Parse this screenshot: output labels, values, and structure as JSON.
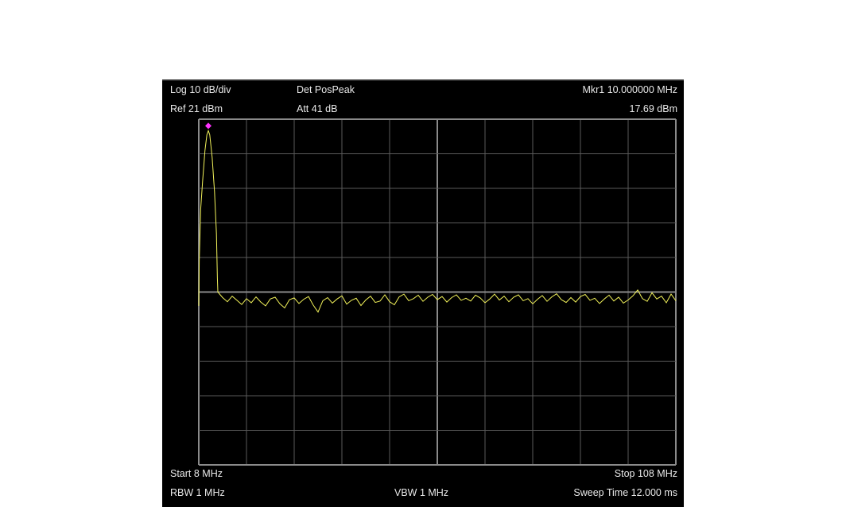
{
  "header": {
    "scale": "Log 10 dB/div",
    "ref_level": "Ref 21 dBm",
    "detector": "Det PosPeak",
    "attenuation": "Att 41 dB",
    "marker_label": "Mkr1  10.000000 MHz",
    "marker_value": "17.69 dBm"
  },
  "footer": {
    "start": "Start 8 MHz",
    "stop": "Stop 108 MHz",
    "rbw": "RBW 1 MHz",
    "vbw": "VBW 1 MHz",
    "sweep": "Sweep Time 12.000 ms"
  },
  "colors": {
    "trace": "#f2f25a",
    "marker": "#ff33ff",
    "grid": "#5a5a5a",
    "center_grid": "#8a8a8a"
  },
  "chart_data": {
    "type": "line",
    "xlim": [
      8,
      108
    ],
    "ylim": [
      -79,
      21
    ],
    "x_unit": "MHz",
    "y_unit": "dBm",
    "grid": true,
    "grid_divisions": [
      10,
      10
    ],
    "marker": {
      "name": "1",
      "x": 10.0,
      "y": 17.69
    },
    "series": [
      {
        "points": [
          [
            8.0,
            -33.0
          ],
          [
            8.1,
            -20.0
          ],
          [
            8.4,
            -5.0
          ],
          [
            8.8,
            3.0
          ],
          [
            9.3,
            12.0
          ],
          [
            9.7,
            16.5
          ],
          [
            10.0,
            17.69
          ],
          [
            10.3,
            16.5
          ],
          [
            10.8,
            10.0
          ],
          [
            11.3,
            0.0
          ],
          [
            11.7,
            -12.0
          ],
          [
            11.9,
            -25.0
          ],
          [
            12.0,
            -29.0
          ],
          [
            13,
            -30.6
          ],
          [
            14,
            -31.8
          ],
          [
            15,
            -30.2
          ],
          [
            16,
            -31.4
          ],
          [
            17,
            -32.6
          ],
          [
            18,
            -30.9
          ],
          [
            19,
            -32.1
          ],
          [
            20,
            -30.4
          ],
          [
            21,
            -31.9
          ],
          [
            22,
            -33.0
          ],
          [
            23,
            -31.0
          ],
          [
            24,
            -30.5
          ],
          [
            25,
            -32.4
          ],
          [
            26,
            -33.6
          ],
          [
            27,
            -31.2
          ],
          [
            28,
            -30.7
          ],
          [
            29,
            -32.3
          ],
          [
            30,
            -31.1
          ],
          [
            31,
            -30.3
          ],
          [
            32,
            -32.8
          ],
          [
            33,
            -34.8
          ],
          [
            34,
            -31.5
          ],
          [
            35,
            -30.6
          ],
          [
            36,
            -32.2
          ],
          [
            37,
            -31.0
          ],
          [
            38,
            -30.1
          ],
          [
            39,
            -32.5
          ],
          [
            40,
            -31.4
          ],
          [
            41,
            -30.8
          ],
          [
            42,
            -32.9
          ],
          [
            43,
            -31.3
          ],
          [
            44,
            -30.2
          ],
          [
            45,
            -32.0
          ],
          [
            46,
            -31.6
          ],
          [
            47,
            -29.8
          ],
          [
            48,
            -31.8
          ],
          [
            49,
            -32.7
          ],
          [
            50,
            -30.4
          ],
          [
            51,
            -29.6
          ],
          [
            52,
            -31.5
          ],
          [
            53,
            -30.9
          ],
          [
            54,
            -29.9
          ],
          [
            55,
            -31.7
          ],
          [
            56,
            -30.5
          ],
          [
            57,
            -29.7
          ],
          [
            58,
            -31.2
          ],
          [
            59,
            -30.3
          ],
          [
            60,
            -31.9
          ],
          [
            61,
            -30.6
          ],
          [
            62,
            -29.8
          ],
          [
            63,
            -31.4
          ],
          [
            64,
            -30.8
          ],
          [
            65,
            -31.6
          ],
          [
            66,
            -29.9
          ],
          [
            67,
            -30.7
          ],
          [
            68,
            -32.1
          ],
          [
            69,
            -31.0
          ],
          [
            70,
            -29.6
          ],
          [
            71,
            -31.3
          ],
          [
            72,
            -30.2
          ],
          [
            73,
            -31.8
          ],
          [
            74,
            -30.5
          ],
          [
            75,
            -29.8
          ],
          [
            76,
            -31.5
          ],
          [
            77,
            -30.9
          ],
          [
            78,
            -32.4
          ],
          [
            79,
            -31.1
          ],
          [
            80,
            -30.0
          ],
          [
            81,
            -31.7
          ],
          [
            82,
            -30.4
          ],
          [
            83,
            -29.5
          ],
          [
            84,
            -31.2
          ],
          [
            85,
            -32.0
          ],
          [
            86,
            -30.6
          ],
          [
            87,
            -31.9
          ],
          [
            88,
            -30.3
          ],
          [
            89,
            -29.7
          ],
          [
            90,
            -31.4
          ],
          [
            91,
            -30.8
          ],
          [
            92,
            -32.3
          ],
          [
            93,
            -31.0
          ],
          [
            94,
            -29.9
          ],
          [
            95,
            -31.6
          ],
          [
            96,
            -30.5
          ],
          [
            97,
            -32.2
          ],
          [
            98,
            -31.3
          ],
          [
            99,
            -30.1
          ],
          [
            100,
            -28.4
          ],
          [
            101,
            -30.9
          ],
          [
            102,
            -31.7
          ],
          [
            103,
            -29.2
          ],
          [
            104,
            -31.0
          ],
          [
            105,
            -30.2
          ],
          [
            106,
            -32.1
          ],
          [
            107,
            -29.6
          ],
          [
            108,
            -31.5
          ]
        ]
      }
    ]
  }
}
